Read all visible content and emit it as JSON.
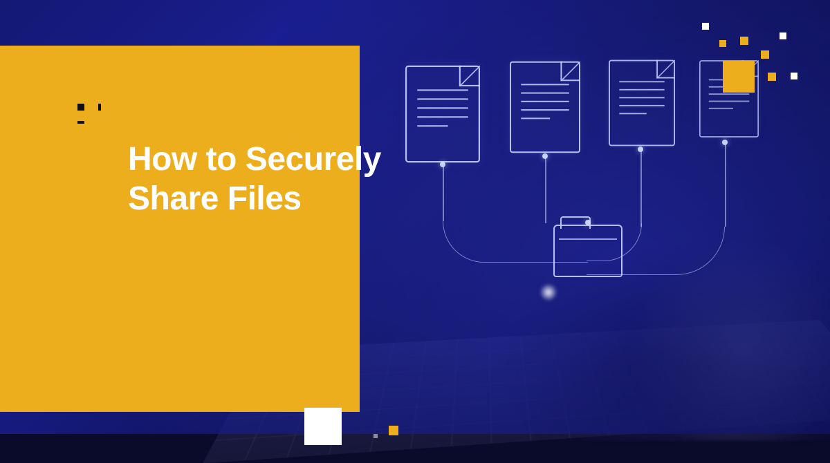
{
  "title_line1": "How to Securely",
  "title_line2": "Share Files",
  "colors": {
    "accent": "#EDAE1E",
    "overlay_blue": "#3B45C8",
    "text": "#FFFFFF"
  },
  "icons": {
    "documents": [
      "document-icon",
      "document-icon",
      "document-icon",
      "document-icon"
    ],
    "folder": "folder-icon"
  }
}
